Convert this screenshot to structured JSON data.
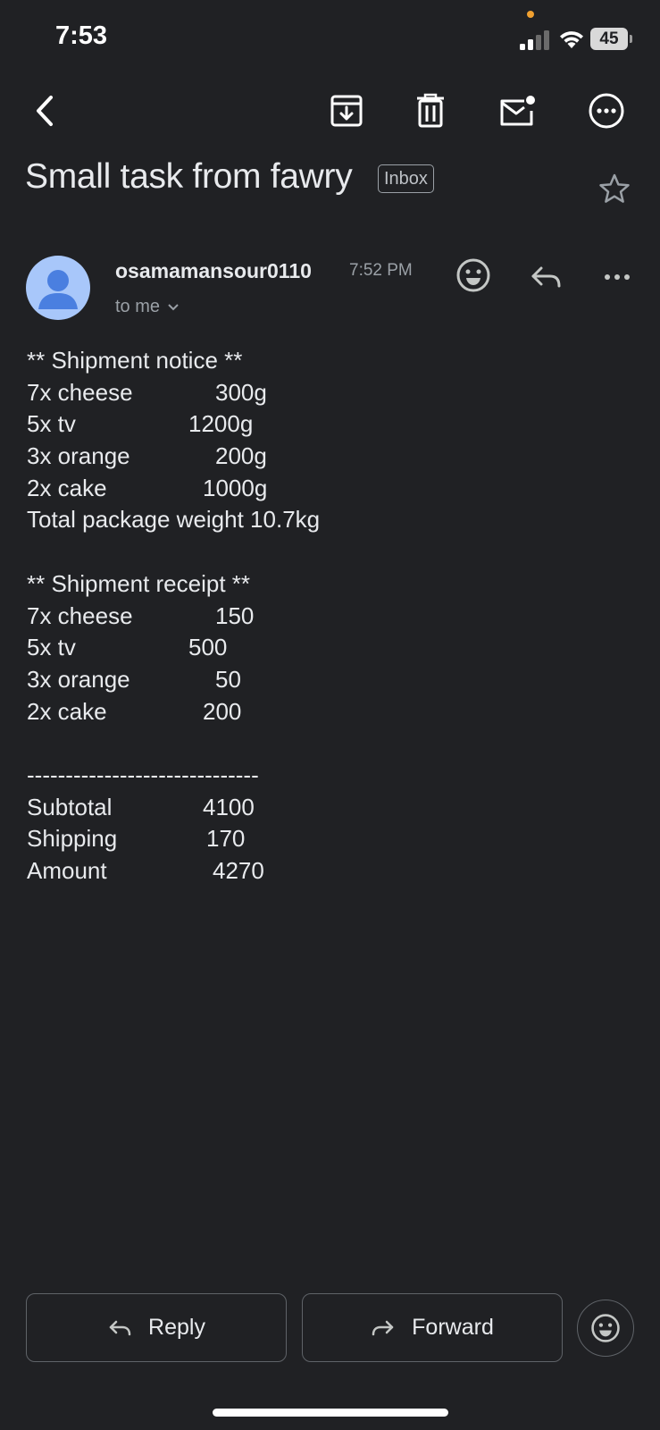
{
  "status_bar": {
    "time": "7:53",
    "battery": "45"
  },
  "toolbar": {
    "back_icon": "chevron-left-icon",
    "archive_icon": "archive-icon",
    "delete_icon": "trash-icon",
    "mark_unread_icon": "mail-unread-icon",
    "more_icon": "more-horizontal-icon"
  },
  "email": {
    "subject": "Small task from fawry",
    "label": "Inbox",
    "sender": "osamamansour0110",
    "time": "7:52 PM",
    "recipient": "to me",
    "notice_header": "** Shipment notice **",
    "notice_items": [
      {
        "name": "7x cheese",
        "value": "300g"
      },
      {
        "name": "5x tv",
        "value": "1200g"
      },
      {
        "name": "3x orange",
        "value": "200g"
      },
      {
        "name": "2x cake",
        "value": "1000g"
      }
    ],
    "total_weight": "Total package weight 10.7kg",
    "receipt_header": "** Shipment receipt **",
    "receipt_items": [
      {
        "name": "7x cheese",
        "value": "150"
      },
      {
        "name": "5x tv",
        "value": "500"
      },
      {
        "name": "3x orange",
        "value": "50"
      },
      {
        "name": "2x cake",
        "value": "200"
      }
    ],
    "divider": "------------------------------",
    "totals": [
      {
        "name": "Subtotal",
        "value": "4100"
      },
      {
        "name": "Shipping",
        "value": "170"
      },
      {
        "name": "Amount",
        "value": "4270"
      }
    ]
  },
  "actions": {
    "reply_label": "Reply",
    "forward_label": "Forward"
  },
  "colors": {
    "background": "#202124",
    "text": "#e8eaed",
    "avatar": "#a8c7fa",
    "avatar_figure": "#4a7fe0",
    "status_dot": "#f0a030"
  }
}
